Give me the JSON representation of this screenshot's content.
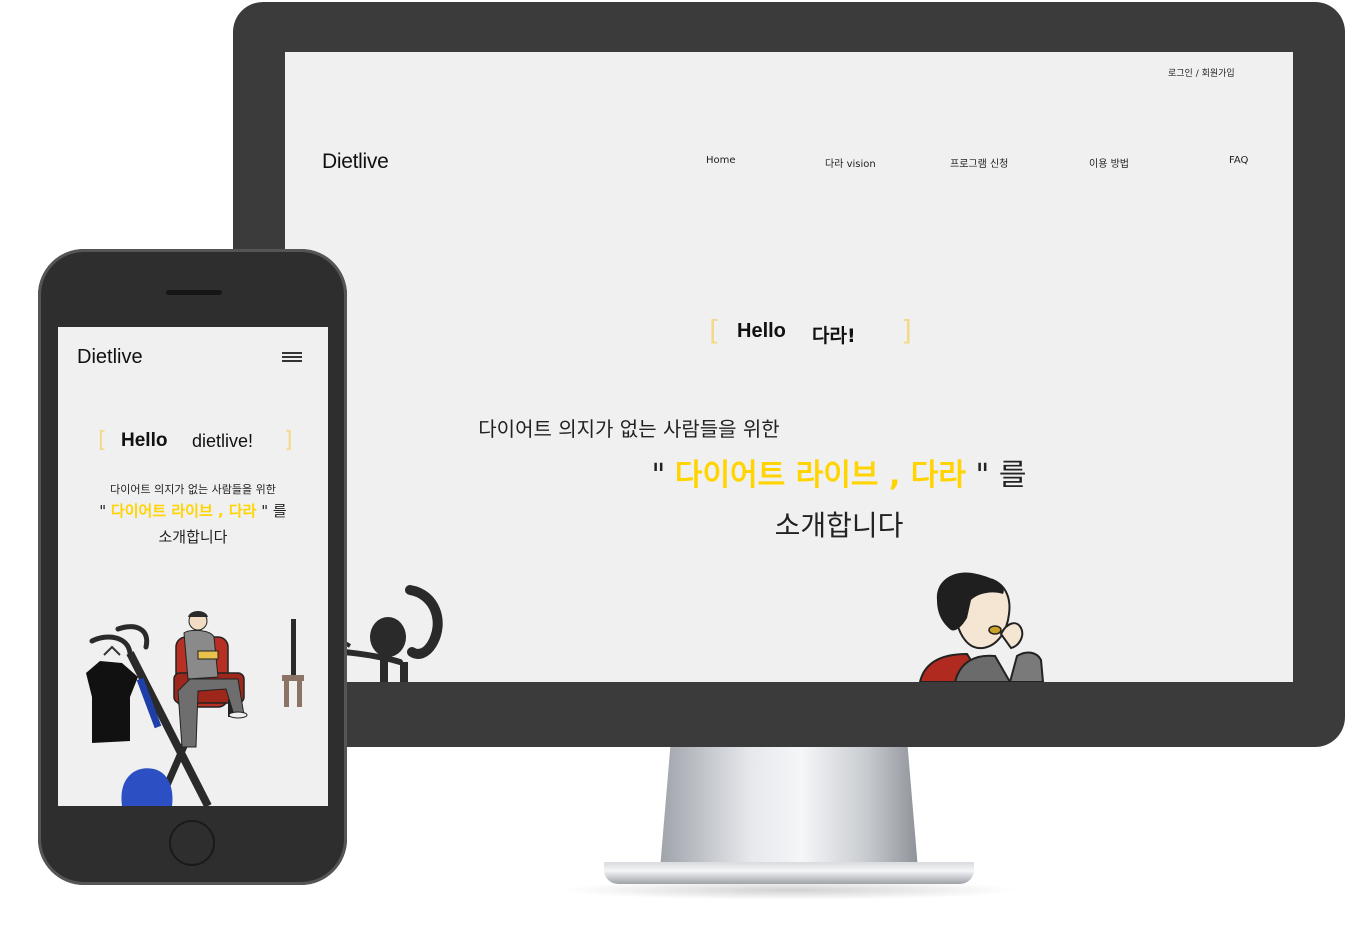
{
  "desktop": {
    "login_link": "로그인 / 회원가입",
    "logo": "Dietlive",
    "nav": [
      "Home",
      "다라 vision",
      "프로그램 신청",
      "이용 방법",
      "FAQ"
    ],
    "hello": "Hello",
    "hello_name": "다라!",
    "intro_line1": "다이어트 의지가 없는 사람들을 위한",
    "quote_open": "\" ",
    "highlight": "다이어트 라이브 , 다라",
    "quote_close": " \" 를",
    "intro_line3": "소개합니다"
  },
  "mobile": {
    "logo": "Dietlive",
    "hello": "Hello",
    "hello_name": "dietlive!",
    "intro_line1": "다이어트 의지가 없는 사람들을 위한",
    "quote_open": "\" ",
    "highlight": "다이어트 라이브 , 다라",
    "quote_close": " \" 를",
    "intro_line3": "소개합니다"
  },
  "colors": {
    "highlight": "#ffd400",
    "bracket": "#f4d98a",
    "device_frame": "#3b3b3b",
    "screen_bg": "#f0f0f0"
  },
  "icons": [
    "hamburger-menu-icon",
    "exercise-bike-illustration",
    "man-eating-illustration",
    "man-on-sofa-illustration"
  ]
}
